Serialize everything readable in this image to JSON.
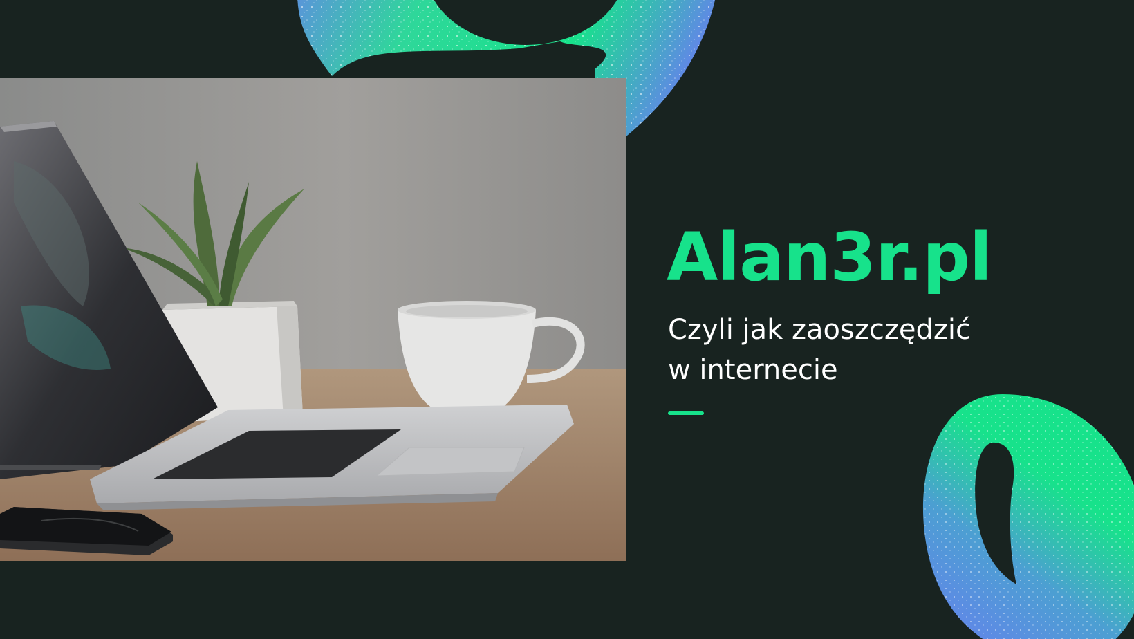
{
  "brand": {
    "title": "Alan3r.pl",
    "subtitle_line1": "Czyli jak zaoszczędzić",
    "subtitle_line2": "w internecie"
  },
  "colors": {
    "background": "#182320",
    "accent_green": "#17e28b",
    "accent_blue": "#6a7cf2",
    "text_white": "#ffffff"
  },
  "photo": {
    "subject": "laptop-plant-coffee-cup-phone-on-desk"
  },
  "decorations": {
    "shapes": [
      "gradient-ring-top",
      "gradient-ring-bottom-right"
    ]
  }
}
